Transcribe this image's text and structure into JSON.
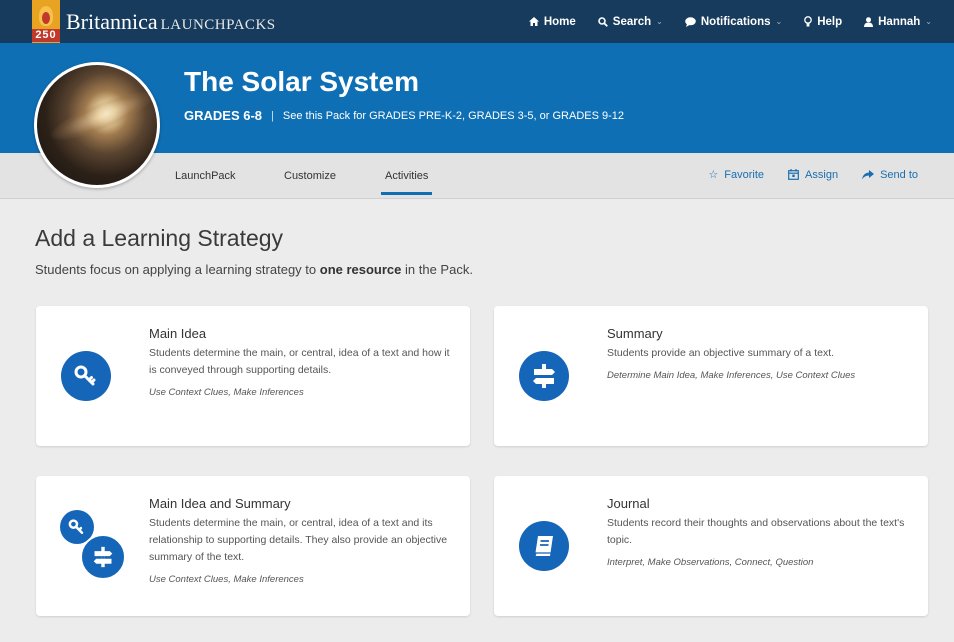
{
  "app": {
    "logo_number": "250",
    "logo_brand": "Britannica",
    "logo_product": "LAUNCHPACKS",
    "nav": {
      "home": "Home",
      "search": "Search",
      "notifications": "Notifications",
      "help": "Help",
      "user": "Hannah"
    }
  },
  "pack": {
    "title": "The Solar System",
    "grade": "GRADES 6-8",
    "separator": "|",
    "other_grades": "See this Pack for GRADES PRE-K-2, GRADES 3-5, or GRADES 9-12"
  },
  "tabs": [
    {
      "label": "LaunchPack"
    },
    {
      "label": "Customize"
    },
    {
      "label": "Activities"
    }
  ],
  "active_tab": "Activities",
  "actions": {
    "favorite": "Favorite",
    "assign": "Assign",
    "send": "Send to"
  },
  "main": {
    "title": "Add a Learning Strategy",
    "desc_before": "Students focus on applying a learning strategy to ",
    "desc_bold": "one resource",
    "desc_after": " in the Pack."
  },
  "strategies": [
    {
      "icon": "key-icon",
      "title": "Main Idea",
      "description": "Students determine the main, or central, idea of a text and how it is conveyed through supporting details.",
      "tags": "Use Context Clues, Make Inferences"
    },
    {
      "icon": "signpost-icon",
      "title": "Summary",
      "description": "Students provide an objective summary of a text.",
      "tags": "Determine Main Idea, Make Inferences, Use Context Clues"
    },
    {
      "icon": "key-signpost-icon",
      "title": "Main Idea and Summary",
      "description": "Students determine the main, or central, idea of a text and its relationship to supporting details. They also provide an objective summary of the text.",
      "tags": "Use Context Clues, Make Inferences"
    },
    {
      "icon": "journal-icon",
      "title": "Journal",
      "description": "Students record their thoughts and observations about the text's topic.",
      "tags": "Interpret, Make Observations, Connect, Question"
    }
  ],
  "colors": {
    "topbar": "#173b5c",
    "hero": "#0f6fb5",
    "accent": "#1565b8",
    "background": "#ececec"
  }
}
